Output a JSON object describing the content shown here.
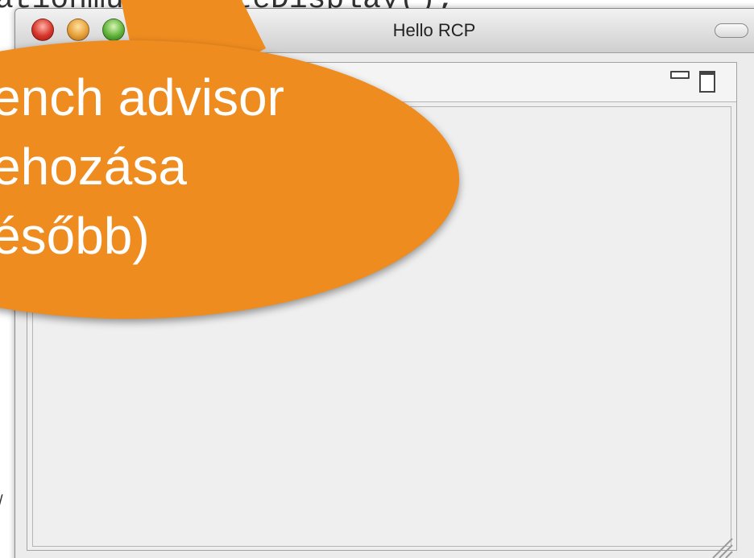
{
  "background_code": {
    "top_line": "ationmui.createDisplay();",
    "left_fragment": "/"
  },
  "window": {
    "title": "Hello RCP",
    "controls": {
      "close_color": "#d7352a",
      "minimize_color": "#e6a03a",
      "zoom_color": "#5fb33a"
    }
  },
  "view": {
    "minimize_icon": "minimize-icon",
    "maximize_icon": "maximize-icon"
  },
  "callout": {
    "color": "#ee8c20",
    "lines": [
      "ench advisor",
      "ehozása",
      "ésőbb)"
    ]
  }
}
